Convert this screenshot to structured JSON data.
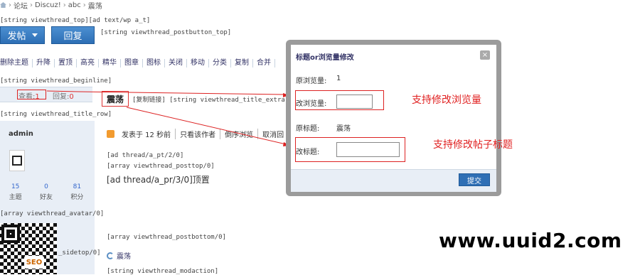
{
  "breadcrumb": [
    "论坛",
    "Discuz!",
    "abc",
    "震荡"
  ],
  "raw": {
    "top": "[string viewthread_top][ad text/wp a_t]",
    "postbutton_top": "[string viewthread_postbutton_top]",
    "beginline": "[string viewthread_beginline]",
    "title_extra": "[复制链接] [string viewthread_title_extra] [标题或",
    "title_row": "[string viewthread_title_row]",
    "ad1": "[ad thread/a_pt/2/0]",
    "posttop": "[array viewthread_posttop/0]",
    "ad2": "[ad thread/a_pr/3/0]顶置",
    "avatar": "[array viewthread_avatar/0]",
    "sidetop": "_sidetop/0]",
    "postbottom": "[array viewthread_postbottom/0]",
    "modaction": "[string viewthread_modaction]"
  },
  "buttons": {
    "post": "发帖",
    "reply": "回复"
  },
  "modbar": [
    "删除主题",
    "升降",
    "置顶",
    "高亮",
    "精华",
    "图章",
    "图标",
    "关闭",
    "移动",
    "分类",
    "复制",
    "合并"
  ],
  "thread": {
    "views_label": "查看:",
    "views": "1",
    "replies_label": "回复:",
    "replies": "0",
    "title": "震荡"
  },
  "author": {
    "name": "admin",
    "stats": [
      {
        "value": "15",
        "label": "主题"
      },
      {
        "value": "0",
        "label": "好友"
      },
      {
        "value": "81",
        "label": "积分"
      }
    ]
  },
  "post_bar": [
    "发表于 12 秒前",
    "只看该作者",
    "倒序浏览",
    "取消回"
  ],
  "post_title_link": "震荡",
  "qr_badge": "SEO",
  "dialog": {
    "title": "标题or浏览量修改",
    "orig_views_label": "原浏览量:",
    "orig_views": "1",
    "new_views_label": "改浏览量:",
    "orig_title_label": "原标题:",
    "orig_title": "震荡",
    "new_title_label": "改标题:",
    "submit": "提交",
    "close": "×"
  },
  "annotations": {
    "views": "支持修改浏览量",
    "title": "支持修改帖子标题"
  },
  "watermark": "www.uuid2.com",
  "colors": {
    "accent": "#2f6fb5",
    "annotation": "#e02020"
  }
}
